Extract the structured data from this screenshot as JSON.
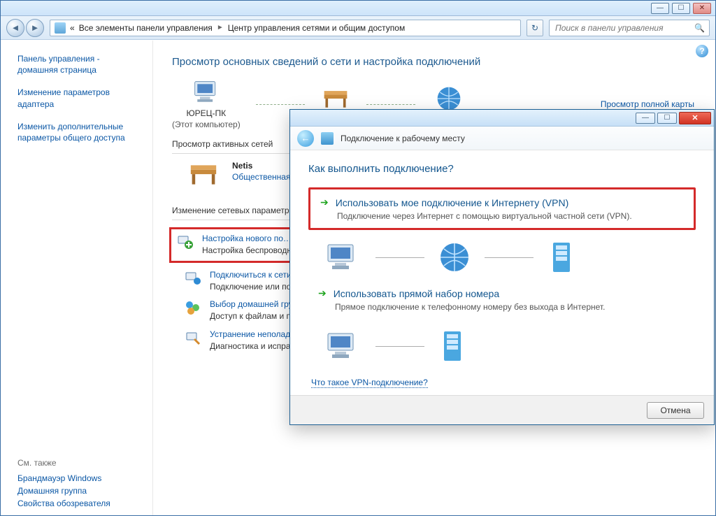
{
  "explorer": {
    "breadcrumb_prefix": "«",
    "crumb1": "Все элементы панели управления",
    "crumb2": "Центр управления сетями и общим доступом",
    "search_placeholder": "Поиск в панели управления"
  },
  "sidebar": {
    "home": "Панель управления - домашняя страница",
    "links": [
      "Изменение параметров адаптера",
      "Изменить дополнительные параметры общего доступа"
    ],
    "see_also_header": "См. также",
    "see_also": [
      "Брандмауэр Windows",
      "Домашняя группа",
      "Свойства обозревателя"
    ]
  },
  "content": {
    "page_title": "Просмотр основных сведений о сети и настройка подключений",
    "full_map_link": "Просмотр полной карты",
    "map": {
      "computer": "ЮРЕЦ-ПК",
      "computer_note": "(Этот компьютер)",
      "router": "Netis",
      "internet": "Интернет"
    },
    "active_nets_title": "Просмотр активных сетей",
    "active_net": {
      "name": "Netis",
      "type": "Общественная сеть"
    },
    "change_params_title": "Изменение сетевых параметров",
    "items": [
      {
        "title": "Настройка нового по…",
        "desc": "Настройка беспроводн… или же настройка мар…"
      },
      {
        "title": "Подключиться к сети",
        "desc": "Подключение или пов… сетевому соединению"
      },
      {
        "title": "Выбор домашней гру…",
        "desc": "Доступ к файлам и при… изменение параметро…"
      },
      {
        "title": "Устранение неполадо…",
        "desc": "Диагностика и испра в…"
      }
    ]
  },
  "dialog": {
    "title": "Подключение к рабочему месту",
    "heading": "Как выполнить подключение?",
    "opt1_title": "Использовать мое подключение к Интернету (VPN)",
    "opt1_desc": "Подключение через Интернет с помощью виртуальной частной сети (VPN).",
    "opt2_title": "Использовать прямой набор номера",
    "opt2_desc": "Прямое подключение к телефонному номеру без выхода в Интернет.",
    "vpn_link": "Что такое VPN-подключение?",
    "cancel": "Отмена"
  }
}
